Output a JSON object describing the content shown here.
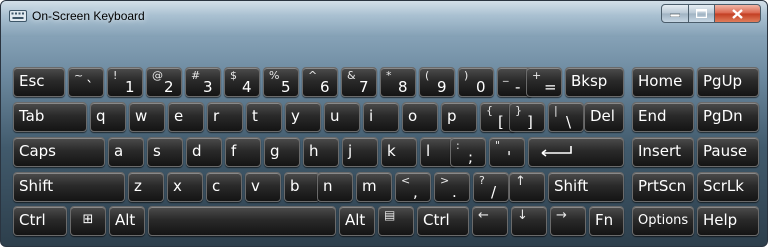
{
  "window": {
    "title": "On-Screen Keyboard"
  },
  "caption": {
    "minimize": "–",
    "maximize": "☐",
    "close": "✕"
  },
  "keys": {
    "esc": "Esc",
    "tilde": {
      "shift": "~",
      "base": "`"
    },
    "d1": {
      "shift": "!",
      "base": "1"
    },
    "d2": {
      "shift": "@",
      "base": "2"
    },
    "d3": {
      "shift": "#",
      "base": "3"
    },
    "d4": {
      "shift": "$",
      "base": "4"
    },
    "d5": {
      "shift": "%",
      "base": "5"
    },
    "d6": {
      "shift": "^",
      "base": "6"
    },
    "d7": {
      "shift": "&",
      "base": "7"
    },
    "d8": {
      "shift": "*",
      "base": "8"
    },
    "d9": {
      "shift": "(",
      "base": "9"
    },
    "d0": {
      "shift": ")",
      "base": "0"
    },
    "minus": {
      "shift": "_",
      "base": "-"
    },
    "equals": {
      "shift": "+",
      "base": "="
    },
    "bksp": "Bksp",
    "home": "Home",
    "pgup": "PgUp",
    "tab": "Tab",
    "q": "q",
    "w": "w",
    "e": "e",
    "r": "r",
    "t": "t",
    "y": "y",
    "u": "u",
    "i": "i",
    "o": "o",
    "p": "p",
    "lbracket": {
      "shift": "{",
      "base": "["
    },
    "rbracket": {
      "shift": "}",
      "base": "]"
    },
    "backslash": {
      "shift": "|",
      "base": "\\"
    },
    "del": "Del",
    "end": "End",
    "pgdn": "PgDn",
    "caps": "Caps",
    "a": "a",
    "s": "s",
    "d": "d",
    "f": "f",
    "g": "g",
    "h": "h",
    "j": "j",
    "k": "k",
    "l": "l",
    "semicolon": {
      "shift": ":",
      "base": ";"
    },
    "quote": {
      "shift": "\"",
      "base": "'"
    },
    "enter": "⏎",
    "insert": "Insert",
    "pause": "Pause",
    "lshift": "Shift",
    "z": "z",
    "x": "x",
    "c": "c",
    "v": "v",
    "b": "b",
    "n": "n",
    "m": "m",
    "comma": {
      "shift": "<",
      "base": ","
    },
    "period": {
      "shift": ">",
      "base": "."
    },
    "slash": {
      "shift": "?",
      "base": "/"
    },
    "up": "↑",
    "rshift": "Shift",
    "prtscn": "PrtScn",
    "scrlk": "ScrLk",
    "lctrl": "Ctrl",
    "win": "⊞",
    "lalt": "Alt",
    "space": "",
    "ralt": "Alt",
    "menu": "▤",
    "rctrl": "Ctrl",
    "left": "←",
    "down": "↓",
    "right": "→",
    "fn": "Fn",
    "options": "Options",
    "help": "Help"
  }
}
